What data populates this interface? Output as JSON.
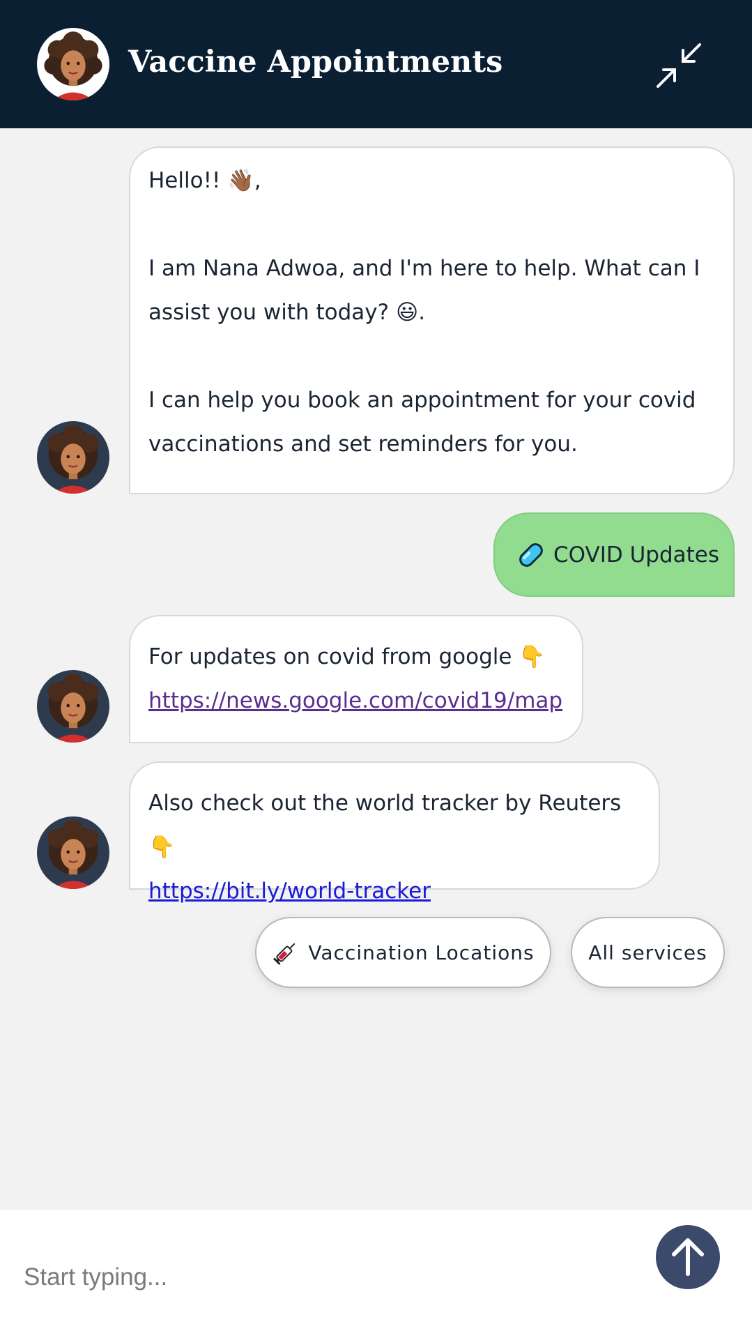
{
  "header": {
    "title": "Vaccine Appointments",
    "background": "#0b1f33",
    "minimize_icon": "collapse-arrows-icon"
  },
  "messages": [
    {
      "sender": "bot",
      "paragraphs": [
        "Hello!! 👋🏾,",
        "I am Nana Adwoa, and I'm here to help. What can I assist you with today? 😃.",
        "I can help you book an appointment for your covid vaccinations and set reminders for you."
      ]
    },
    {
      "sender": "user",
      "icon": "pill-icon",
      "text": "COVID Updates"
    },
    {
      "sender": "bot",
      "text": "For updates on covid from google 👇",
      "link": "https://news.google.com/covid19/map"
    },
    {
      "sender": "bot",
      "text": "Also check out the world tracker by Reuters 👇",
      "link": "https://bit.ly/world-tracker"
    }
  ],
  "quick_replies": [
    {
      "icon": "syringe-icon",
      "label": "Vaccination Locations"
    },
    {
      "label": "All services"
    }
  ],
  "composer": {
    "placeholder": "Start typing...",
    "send_icon": "arrow-up-icon"
  },
  "colors": {
    "user_bubble": "#92dc8f",
    "send_button": "#3b4a6b",
    "link": "#1a1ad8",
    "visited_link": "#5a2d91"
  }
}
